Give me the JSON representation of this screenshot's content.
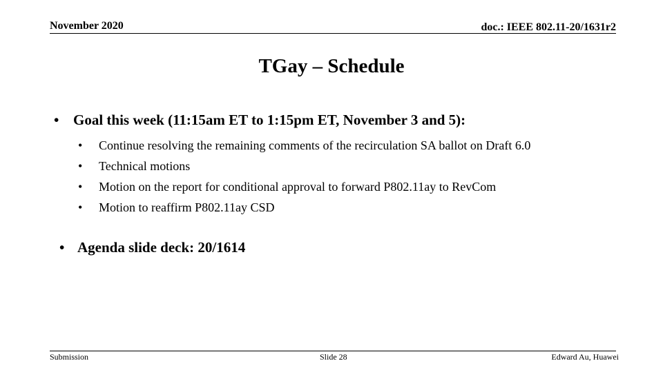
{
  "header": {
    "date": "November 2020",
    "doc_id": "doc.: IEEE 802.11-20/1631r2"
  },
  "title": "TGay – Schedule",
  "bullets": [
    {
      "text": "Goal this week (11:15am ET to 1:15pm ET, November 3 and 5):",
      "sub_items": [
        "Continue resolving the remaining comments of the recirculation SA ballot on Draft 6.0",
        "Technical motions",
        "Motion on the report for conditional approval to forward P802.11ay to RevCom",
        "Motion to reaffirm P802.11ay CSD"
      ]
    },
    {
      "text": "Agenda slide deck:  20/1614"
    }
  ],
  "bullet_glyph": "•",
  "footer": {
    "left": "Submission",
    "center": "Slide 28",
    "right": "Edward Au, Huawei"
  }
}
